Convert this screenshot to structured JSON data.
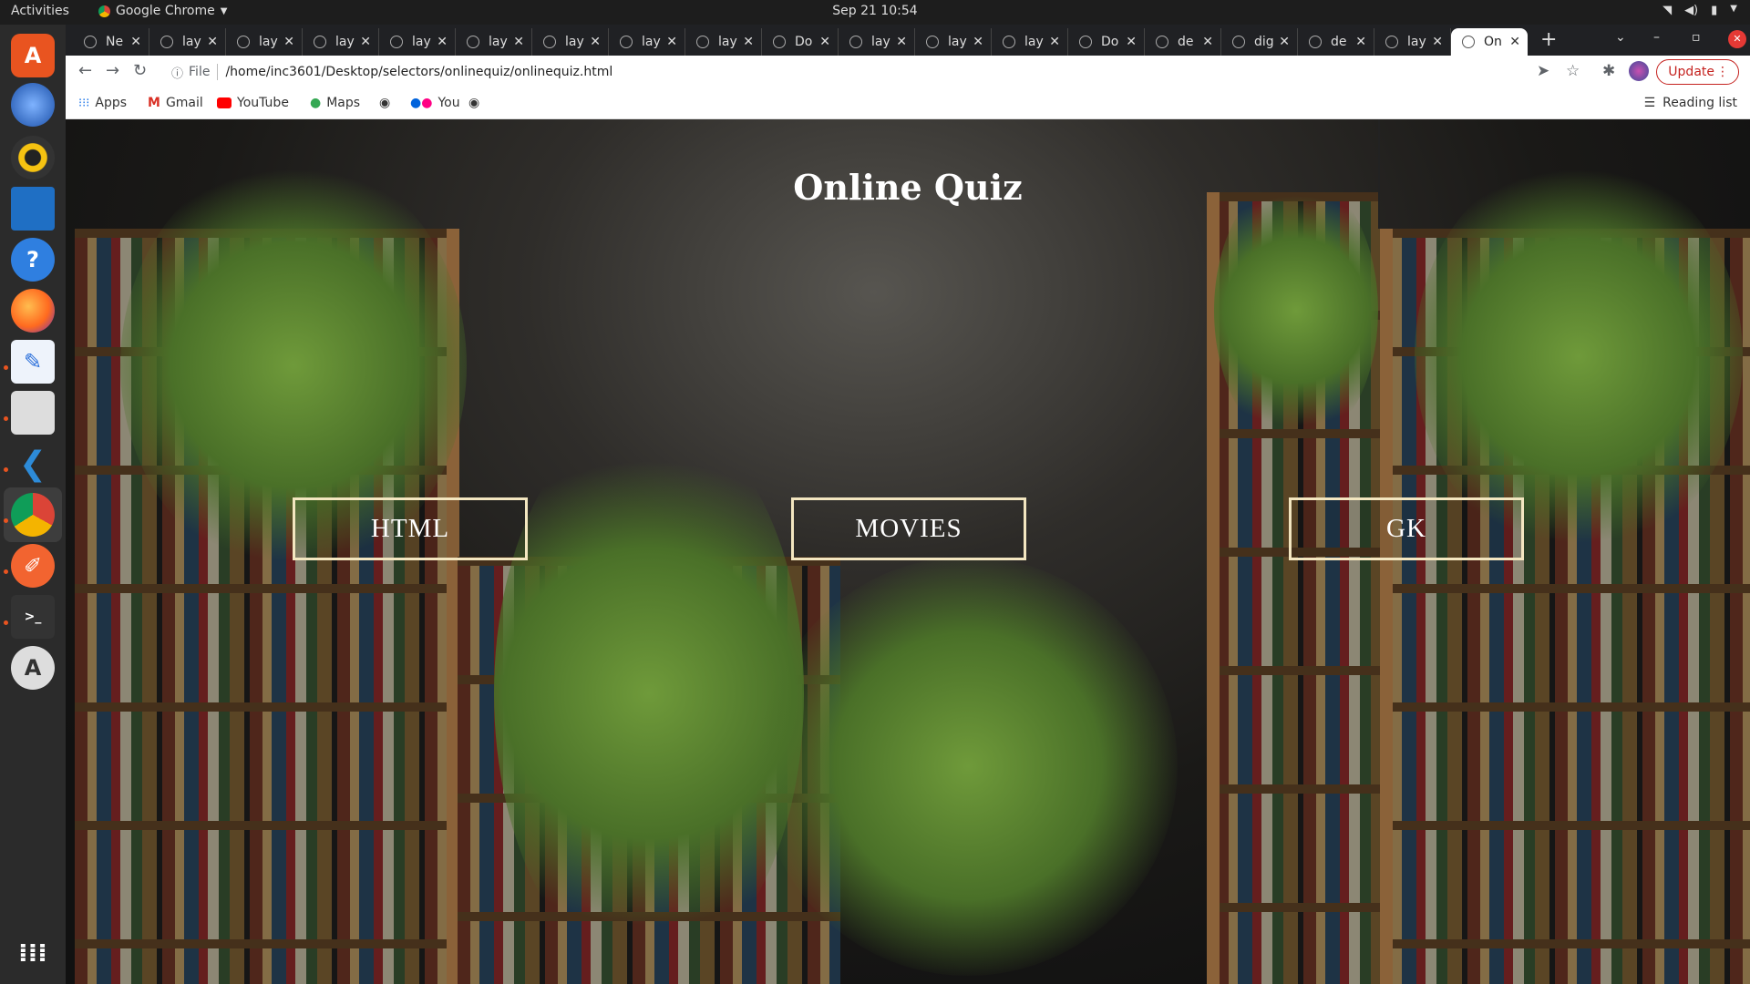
{
  "system": {
    "activities": "Activities",
    "app_name": "Google Chrome",
    "clock": "Sep 21  10:54"
  },
  "browser": {
    "tabs": [
      {
        "label": "Ne"
      },
      {
        "label": "lay"
      },
      {
        "label": "lay"
      },
      {
        "label": "lay"
      },
      {
        "label": "lay"
      },
      {
        "label": "lay"
      },
      {
        "label": "lay"
      },
      {
        "label": "lay"
      },
      {
        "label": "lay"
      },
      {
        "label": "Do"
      },
      {
        "label": "lay"
      },
      {
        "label": "lay"
      },
      {
        "label": "lay"
      },
      {
        "label": "Do"
      },
      {
        "label": "de"
      },
      {
        "label": "dig"
      },
      {
        "label": "de"
      },
      {
        "label": "lay"
      },
      {
        "label": "On",
        "active": true
      }
    ],
    "address_scheme": "File",
    "address_url": "/home/inc3601/Desktop/selectors/onlinequiz/onlinequiz.html",
    "update_label": "Update",
    "bookmarks": [
      {
        "label": "Apps",
        "icon": "apps-grid-icon"
      },
      {
        "label": "Gmail",
        "icon": "gmail-icon"
      },
      {
        "label": "YouTube",
        "icon": "youtube-icon"
      },
      {
        "label": "Maps",
        "icon": "maps-pin-icon"
      },
      {
        "label": "",
        "icon": "globe-icon"
      },
      {
        "label": "You",
        "icon": "flickr-icon"
      },
      {
        "label": "",
        "icon": "globe-icon"
      }
    ],
    "reading_list": "Reading list"
  },
  "page": {
    "title": "Online Quiz",
    "buttons": [
      {
        "label": "HTML"
      },
      {
        "label": "MOVIES"
      },
      {
        "label": "GK"
      }
    ]
  }
}
